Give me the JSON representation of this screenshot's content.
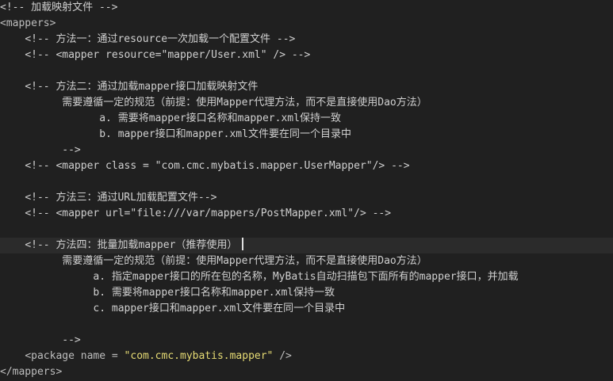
{
  "editor": {
    "lines": [
      {
        "indent": "",
        "kind": "comment",
        "text": "<!-- 加载映射文件 -->"
      },
      {
        "indent": "",
        "kind": "tag",
        "text": "<mappers>"
      },
      {
        "indent": "    ",
        "kind": "comment",
        "text": "<!-- 方法一：通过resource一次加载一个配置文件 -->"
      },
      {
        "indent": "    ",
        "kind": "comment",
        "text": "<!-- <mapper resource=\"mapper/User.xml\" /> -->"
      },
      {
        "indent": "",
        "kind": "blank",
        "text": ""
      },
      {
        "indent": "    ",
        "kind": "comment",
        "text": "<!-- 方法二：通过加载mapper接口加载映射文件"
      },
      {
        "indent": "          ",
        "kind": "comment",
        "text": "需要遵循一定的规范（前提：使用Mapper代理方法，而不是直接使用Dao方法）"
      },
      {
        "indent": "                ",
        "kind": "comment",
        "text": "a. 需要将mapper接口名称和mapper.xml保持一致"
      },
      {
        "indent": "                ",
        "kind": "comment",
        "text": "b. mapper接口和mapper.xml文件要在同一个目录中"
      },
      {
        "indent": "          ",
        "kind": "comment",
        "text": "-->"
      },
      {
        "indent": "    ",
        "kind": "comment",
        "text": "<!-- <mapper class = \"com.cmc.mybatis.mapper.UserMapper\"/> -->"
      },
      {
        "indent": "",
        "kind": "blank",
        "text": ""
      },
      {
        "indent": "    ",
        "kind": "comment",
        "text": "<!-- 方法三：通过URL加载配置文件-->"
      },
      {
        "indent": "    ",
        "kind": "comment",
        "text": "<!-- <mapper url=\"file:///var/mappers/PostMapper.xml\"/> -->"
      },
      {
        "indent": "",
        "kind": "blank",
        "text": ""
      },
      {
        "indent": "    ",
        "kind": "comment",
        "text": "<!-- 方法四：批量加载mapper（推荐使用）",
        "current": true
      },
      {
        "indent": "          ",
        "kind": "comment",
        "text": "需要遵循一定的规范（前提：使用Mapper代理方法，而不是直接使用Dao方法）"
      },
      {
        "indent": "               ",
        "kind": "comment",
        "text": "a. 指定mapper接口的所在包的名称，MyBatis自动扫描包下面所有的mapper接口，并加载"
      },
      {
        "indent": "               ",
        "kind": "comment",
        "text": "b. 需要将mapper接口名称和mapper.xml保持一致"
      },
      {
        "indent": "               ",
        "kind": "comment",
        "text": "c. mapper接口和mapper.xml文件要在同一个目录中"
      },
      {
        "indent": "",
        "kind": "blank",
        "text": ""
      },
      {
        "indent": "          ",
        "kind": "comment",
        "text": "-->"
      },
      {
        "indent": "    ",
        "kind": "package",
        "text_before": "<package name = ",
        "value": "\"com.cmc.mybatis.mapper\"",
        "text_after": " />"
      },
      {
        "indent": "",
        "kind": "tag",
        "text": "</mappers>"
      }
    ]
  }
}
